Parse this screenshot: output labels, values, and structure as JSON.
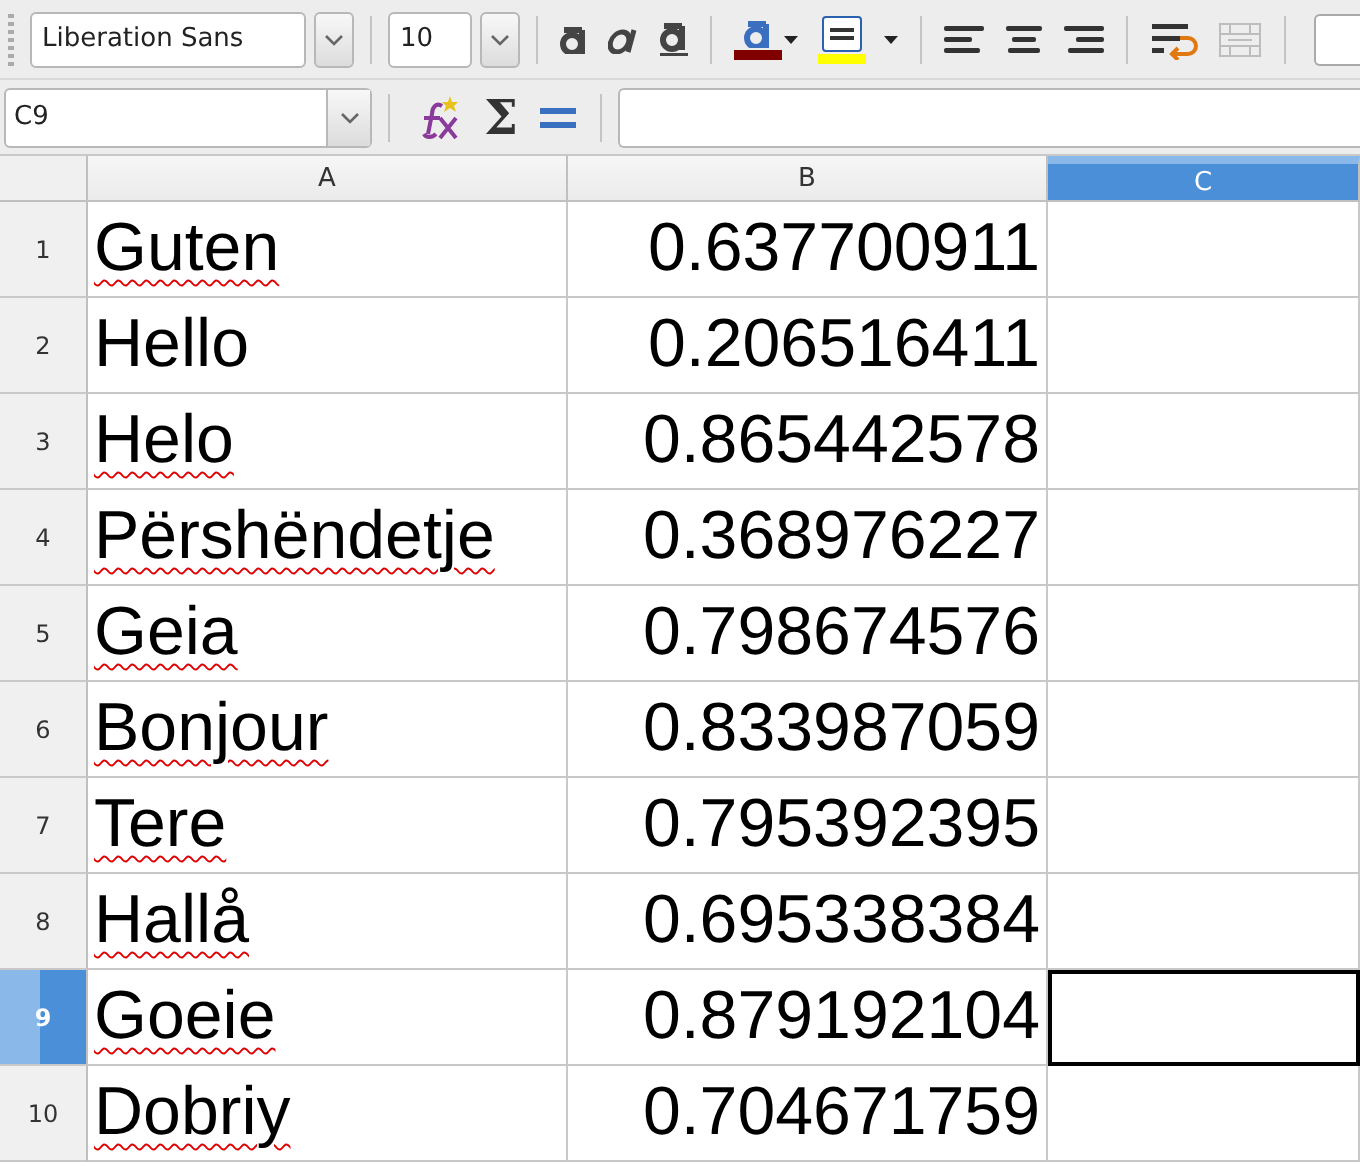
{
  "toolbar": {
    "font_name": "Liberation Sans",
    "font_size": "10",
    "font_color": {
      "color": "#800000"
    },
    "highlight": {
      "color": "#ffff00"
    },
    "merge_disabled": true
  },
  "formula_bar": {
    "name_box": "C9",
    "sum_symbol": "Σ"
  },
  "sheet": {
    "columns": [
      {
        "label": "A",
        "selected": false
      },
      {
        "label": "B",
        "selected": false
      },
      {
        "label": "C",
        "selected": true
      }
    ],
    "rows": [
      {
        "number": "1",
        "selected": false,
        "word": {
          "text": "Guten",
          "misspelled": true
        },
        "value": "0.637700911",
        "cursor": false
      },
      {
        "number": "2",
        "selected": false,
        "word": {
          "text": "Hello",
          "misspelled": false
        },
        "value": "0.206516411",
        "cursor": false
      },
      {
        "number": "3",
        "selected": false,
        "word": {
          "text": "Helo",
          "misspelled": true
        },
        "value": "0.865442578",
        "cursor": false
      },
      {
        "number": "4",
        "selected": false,
        "word": {
          "text": "Përshëndetje",
          "misspelled": true
        },
        "value": "0.368976227",
        "cursor": false
      },
      {
        "number": "5",
        "selected": false,
        "word": {
          "text": "Geia",
          "misspelled": true
        },
        "value": "0.798674576",
        "cursor": false
      },
      {
        "number": "6",
        "selected": false,
        "word": {
          "text": "Bonjour",
          "misspelled": true
        },
        "value": "0.833987059",
        "cursor": false
      },
      {
        "number": "7",
        "selected": false,
        "word": {
          "text": "Tere",
          "misspelled": true
        },
        "value": "0.795392395",
        "cursor": false
      },
      {
        "number": "8",
        "selected": false,
        "word": {
          "text": "Hallå",
          "misspelled": true
        },
        "value": "0.695338384",
        "cursor": false
      },
      {
        "number": "9",
        "selected": true,
        "word": {
          "text": "Goeie",
          "misspelled": true
        },
        "value": "0.879192104",
        "cursor": true
      },
      {
        "number": "10",
        "selected": false,
        "word": {
          "text": "Dobriy",
          "misspelled": true
        },
        "value": "0.704671759",
        "cursor": false
      }
    ]
  }
}
